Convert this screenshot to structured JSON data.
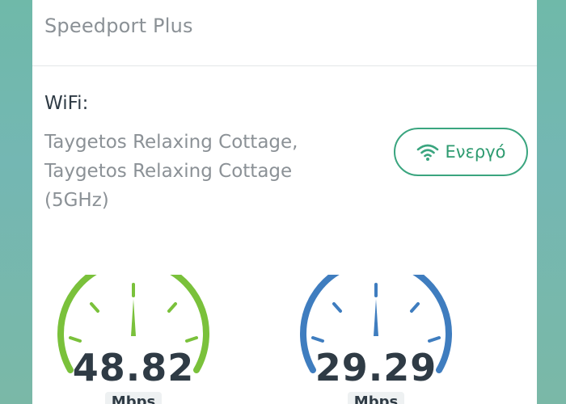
{
  "router": {
    "model": "Speedport Plus"
  },
  "wifi": {
    "label": "WiFi:",
    "networks": [
      "Taygetos Relaxing Cottage,",
      "Taygetos Relaxing Cottage",
      "(5GHz)"
    ],
    "status_label": "Ενεργό",
    "status_icon": "wifi-icon",
    "status_color": "#3aa57f"
  },
  "gauges": [
    {
      "value": "48.82",
      "unit": "Mbps",
      "color": "#7ac13b",
      "icon": "speedometer-icon"
    },
    {
      "value": "29.29",
      "unit": "Mbps",
      "color": "#3f7dbf",
      "icon": "speedometer-icon"
    }
  ]
}
